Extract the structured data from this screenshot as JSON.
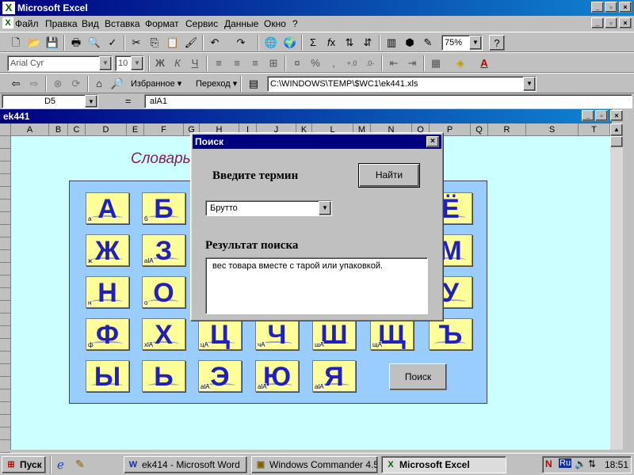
{
  "app": {
    "title": "Microsoft Excel",
    "icon_glyph": "X",
    "window_buttons": [
      "_",
      "▫",
      "×"
    ]
  },
  "menu": {
    "items": [
      "Файл",
      "Правка",
      "Вид",
      "Вставка",
      "Формат",
      "Сервис",
      "Данные",
      "Окно",
      "?"
    ]
  },
  "toolbar": {
    "zoom": "75%",
    "font": "Arial Cyr",
    "font_size": "10",
    "bold": "Ж",
    "italic": "К",
    "underline": "Ч",
    "percent": "%",
    "comma": ",",
    "favorites_label": "Избранное ▾",
    "goto_label": "Переход ▾",
    "address": "C:\\WINDOWS\\TEMP\\$WC1\\ek441.xls"
  },
  "formula_bar": {
    "cell_ref": "D5",
    "equals": "=",
    "formula": "alA1"
  },
  "workbook": {
    "title": "ek441",
    "columns": [
      "A",
      "B",
      "C",
      "D",
      "E",
      "F",
      "G",
      "H",
      "I",
      "J",
      "K",
      "L",
      "M",
      "N",
      "O",
      "P",
      "Q",
      "R",
      "S",
      "T"
    ],
    "row_numbers": [
      "1",
      "2",
      "3",
      "4",
      "5",
      "6",
      "7",
      "8",
      "9",
      "10",
      "11",
      "12",
      "13",
      "14",
      "15",
      "16",
      "17",
      "18",
      "19",
      "20",
      "21",
      "22",
      "23",
      "24",
      "25"
    ],
    "sheet_title": "Словарь",
    "letters": [
      {
        "big": "А",
        "small": "а"
      },
      {
        "big": "Б",
        "small": "б"
      },
      {
        "big": "Ё",
        "small": ""
      },
      {
        "big": "Ж",
        "small": "ж"
      },
      {
        "big": "З",
        "small": "alA"
      },
      {
        "big": "М",
        "small": ""
      },
      {
        "big": "Н",
        "small": "н"
      },
      {
        "big": "О",
        "small": "о"
      },
      {
        "big": "У",
        "small": ""
      },
      {
        "big": "Ф",
        "small": "ф"
      },
      {
        "big": "Х",
        "small": "xlA"
      },
      {
        "big": "Ц",
        "small": "цA"
      },
      {
        "big": "Ч",
        "small": "чA"
      },
      {
        "big": "Ш",
        "small": "шA"
      },
      {
        "big": "Щ",
        "small": "щA"
      },
      {
        "big": "Ъ",
        "small": ""
      },
      {
        "big": "Ы",
        "small": ""
      },
      {
        "big": "Ь",
        "small": ""
      },
      {
        "big": "Э",
        "small": "alA"
      },
      {
        "big": "Ю",
        "small": "alA"
      },
      {
        "big": "Я",
        "small": "alA"
      }
    ],
    "search_button": "Поиск"
  },
  "dialog": {
    "title": "Поиск",
    "close": "×",
    "prompt": "Введите термин",
    "find_button": "Найти",
    "selected_term": "Брутто",
    "result_label": "Результат поиска",
    "result_text": "вес товара вместе с тарой или упаковкой."
  },
  "taskbar": {
    "start": "Пуск",
    "tasks": [
      "ek414 - Microsoft Word",
      "Windows Commander 4.51...",
      "Microsoft Excel"
    ],
    "lang": "Ru",
    "time": "18:51"
  },
  "colors": {
    "sheet_bg": "#ccffff",
    "panel_bg": "#99ccff",
    "letter_bg": "#ffff99",
    "letter_fg": "#2020c0",
    "title_bar": "#000080"
  }
}
